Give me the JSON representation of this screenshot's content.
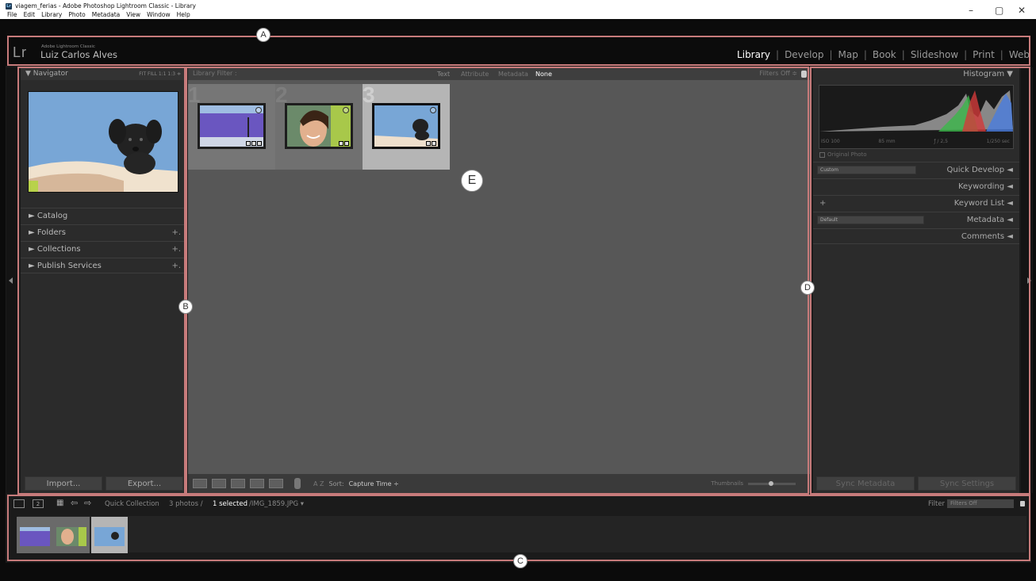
{
  "window": {
    "title": "viagem_ferias - Adobe Photoshop Lightroom Classic - Library",
    "menu": [
      "File",
      "Edit",
      "Library",
      "Photo",
      "Metadata",
      "View",
      "Window",
      "Help"
    ],
    "controls": [
      "–",
      "▢",
      "✕"
    ]
  },
  "identity": {
    "logo": "Lr",
    "app_name": "Adobe Lightroom Classic",
    "user": "Luiz Carlos Alves"
  },
  "modules": [
    "Library",
    "Develop",
    "Map",
    "Book",
    "Slideshow",
    "Print",
    "Web"
  ],
  "active_module": "Library",
  "left_panel": {
    "navigator": {
      "title": "▼ Navigator",
      "zoom": "FIT  FILL  1:1  1:3 ≑"
    },
    "sections": [
      {
        "label": "►  Catalog",
        "plus": ""
      },
      {
        "label": "►  Folders",
        "plus": "+."
      },
      {
        "label": "►  Collections",
        "plus": "+."
      },
      {
        "label": "►  Publish Services",
        "plus": "+."
      }
    ],
    "import_label": "Import...",
    "export_label": "Export..."
  },
  "filter_bar": {
    "title": "Library Filter :",
    "tabs": [
      "Text",
      "Attribute",
      "Metadata",
      "None"
    ],
    "active_tab": "None",
    "filters_off": "Filters Off ≑"
  },
  "grid": {
    "cells": [
      {
        "num": "1",
        "selected": false,
        "colors": [
          "#7ea9d8",
          "#6f5fbf",
          "#2f2a6e"
        ]
      },
      {
        "num": "2",
        "selected": false,
        "colors": [
          "#b8d060",
          "#7a4c33",
          "#e8c6a6"
        ]
      },
      {
        "num": "3",
        "selected": true,
        "colors": [
          "#6c9dd5",
          "#a2c3e8",
          "#1a1a1a"
        ]
      }
    ]
  },
  "toolbar": {
    "sort_label": "Sort:",
    "sort_value": "Capture Time ÷",
    "thumbnails_label": "Thumbnails",
    "az_label": "A Z"
  },
  "right_panel": {
    "histogram_title": "Histogram ▼",
    "exif": [
      "ISO 100",
      "85 mm",
      "ƒ / 2,5",
      "1/250 sec"
    ],
    "original_photo": "Original Photo",
    "panels": [
      {
        "label": "Quick Develop  ◄",
        "dropdown": "Custom"
      },
      {
        "label": "Keywording  ◄",
        "dropdown": ""
      },
      {
        "label": "Keyword List  ◄",
        "dropdown": "+"
      },
      {
        "label": "Metadata  ◄",
        "dropdown": "Default"
      },
      {
        "label": "Comments  ◄",
        "dropdown": ""
      }
    ],
    "sync_metadata": "Sync Metadata",
    "sync_settings": "Sync Settings"
  },
  "filmstrip": {
    "view1": "1",
    "view2": "2",
    "source": "Quick Collection",
    "count_text": "3 photos /",
    "selected_text": "1 selected",
    "file_text": "/IMG_1859.JPG ▾",
    "filter_label": "Filter :",
    "filter_value": "Filters Off"
  },
  "annotations": {
    "A": "A",
    "B": "B",
    "C": "C",
    "D": "D",
    "E": "E"
  }
}
